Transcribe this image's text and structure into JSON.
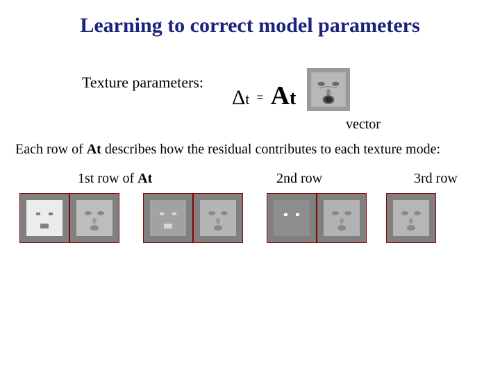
{
  "title": "Learning to correct model parameters",
  "textureLabel": "Texture parameters:",
  "equation": {
    "delta": "Δ",
    "t": "t",
    "eq": "=",
    "A": "A",
    "sub_t": "t"
  },
  "vectorLabel": "vector",
  "description": {
    "pre": "Each row of ",
    "At": "At",
    "post": " describes how the residual contributes to each texture mode:"
  },
  "rowLabels": {
    "r1_pre": "1st row",
    "r1_of": " of ",
    "r1_At": "At",
    "r2": "2nd row",
    "r3": "3rd row"
  },
  "faces": {
    "pairs": [
      {
        "left": "face-sim-light",
        "right": "face-tex-1"
      },
      {
        "left": "face-sim-dark",
        "right": "face-tex-2"
      },
      {
        "left": "face-sim-dots",
        "right": "face-tex-3"
      }
    ],
    "trailing": "face-tex-4"
  },
  "equationFace": "face-tex-eq"
}
